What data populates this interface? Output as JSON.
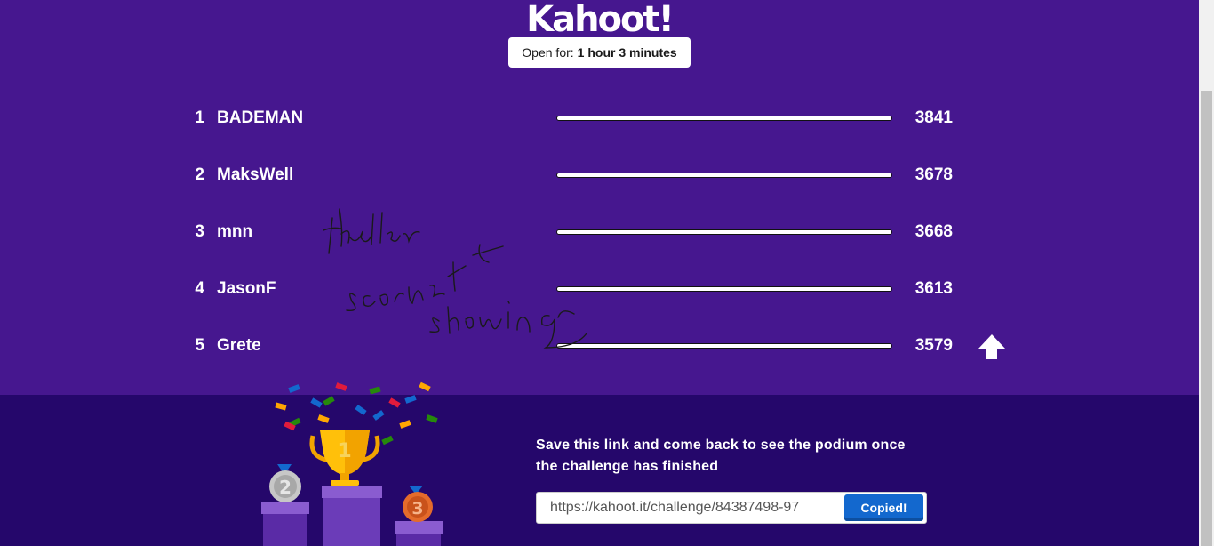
{
  "logo": "Kahoot!",
  "timer": {
    "label": "Open for:",
    "value": "1 hour 3 minutes"
  },
  "leaderboard": [
    {
      "rank": "1",
      "name": "BADEMAN",
      "score": "3841",
      "progress": 1.0
    },
    {
      "rank": "2",
      "name": "MaksWell",
      "score": "3678",
      "progress": 1.0
    },
    {
      "rank": "3",
      "name": "mnn",
      "score": "3668",
      "progress": 1.0
    },
    {
      "rank": "4",
      "name": "JasonF",
      "score": "3613",
      "progress": 1.0
    },
    {
      "rank": "5",
      "name": "Grete",
      "score": "3579",
      "progress": 1.0
    }
  ],
  "save_message": "Save this link and come back to see the podium once the challenge has finished",
  "link": {
    "value": "https://kahoot.it/challenge/84387498-97",
    "button": "Copied!"
  },
  "podium_icons": [
    "trophy-icon",
    "silver-medal-icon",
    "bronze-medal-icon",
    "confetti"
  ],
  "colors": {
    "background": "#46178f",
    "bottom_band": "#25076b",
    "button": "#1368ce"
  }
}
